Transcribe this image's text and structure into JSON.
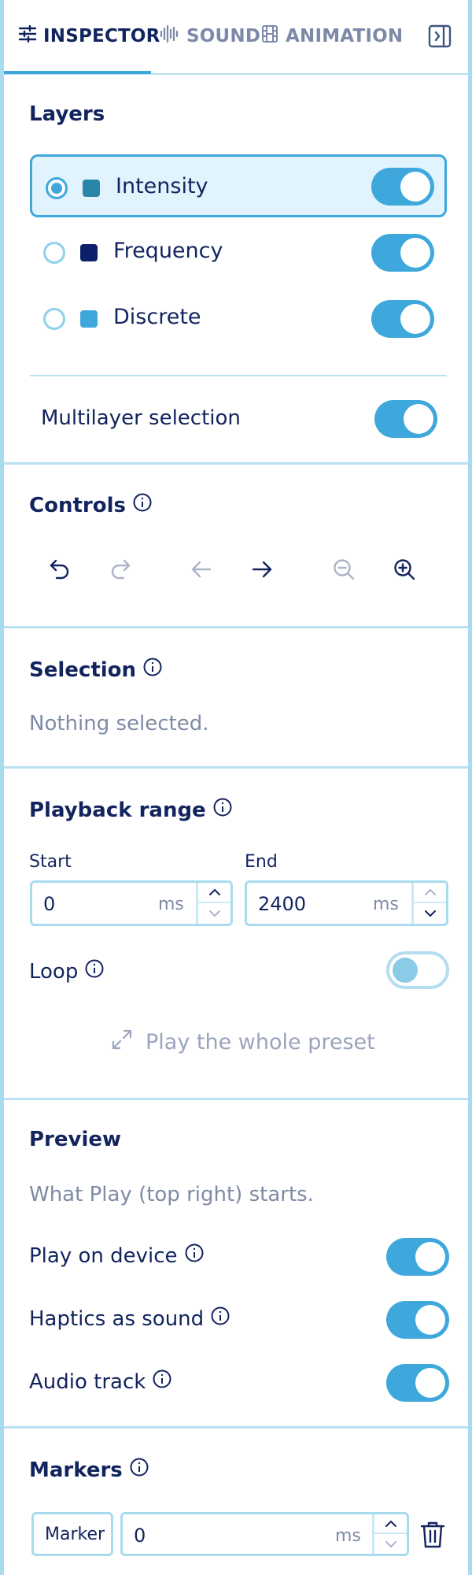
{
  "tabs": [
    {
      "label": "INSPECTOR",
      "icon": "sliders-icon",
      "active": true
    },
    {
      "label": "SOUND",
      "icon": "waveform-icon",
      "active": false
    },
    {
      "label": "ANIMATION",
      "icon": "film-icon",
      "active": false
    }
  ],
  "layers": {
    "title": "Layers",
    "items": [
      {
        "label": "Intensity",
        "color": "#2a86a8",
        "selected": true,
        "enabled": true
      },
      {
        "label": "Frequency",
        "color": "#0c1f6b",
        "selected": false,
        "enabled": true
      },
      {
        "label": "Discrete",
        "color": "#3ea8dc",
        "selected": false,
        "enabled": true
      }
    ],
    "multilayer_label": "Multilayer selection",
    "multilayer_enabled": true
  },
  "controls": {
    "title": "Controls"
  },
  "selection": {
    "title": "Selection",
    "empty_text": "Nothing selected."
  },
  "playback": {
    "title": "Playback range",
    "start_label": "Start",
    "start_value": "0",
    "end_label": "End",
    "end_value": "2400",
    "unit": "ms",
    "loop_label": "Loop",
    "loop_enabled": false,
    "play_whole_label": "Play the whole preset"
  },
  "preview": {
    "title": "Preview",
    "description": "What Play (top right) starts.",
    "play_on_device_label": "Play on device",
    "haptics_as_sound_label": "Haptics as sound",
    "audio_track_label": "Audio track"
  },
  "markers": {
    "title": "Markers",
    "name_value": "Marker",
    "time_value": "0",
    "unit": "ms"
  },
  "colors": {
    "accent": "#3ea8dc",
    "text": "#12245e",
    "border": "#a9dbee",
    "selected_bg": "#e1f3fc"
  }
}
